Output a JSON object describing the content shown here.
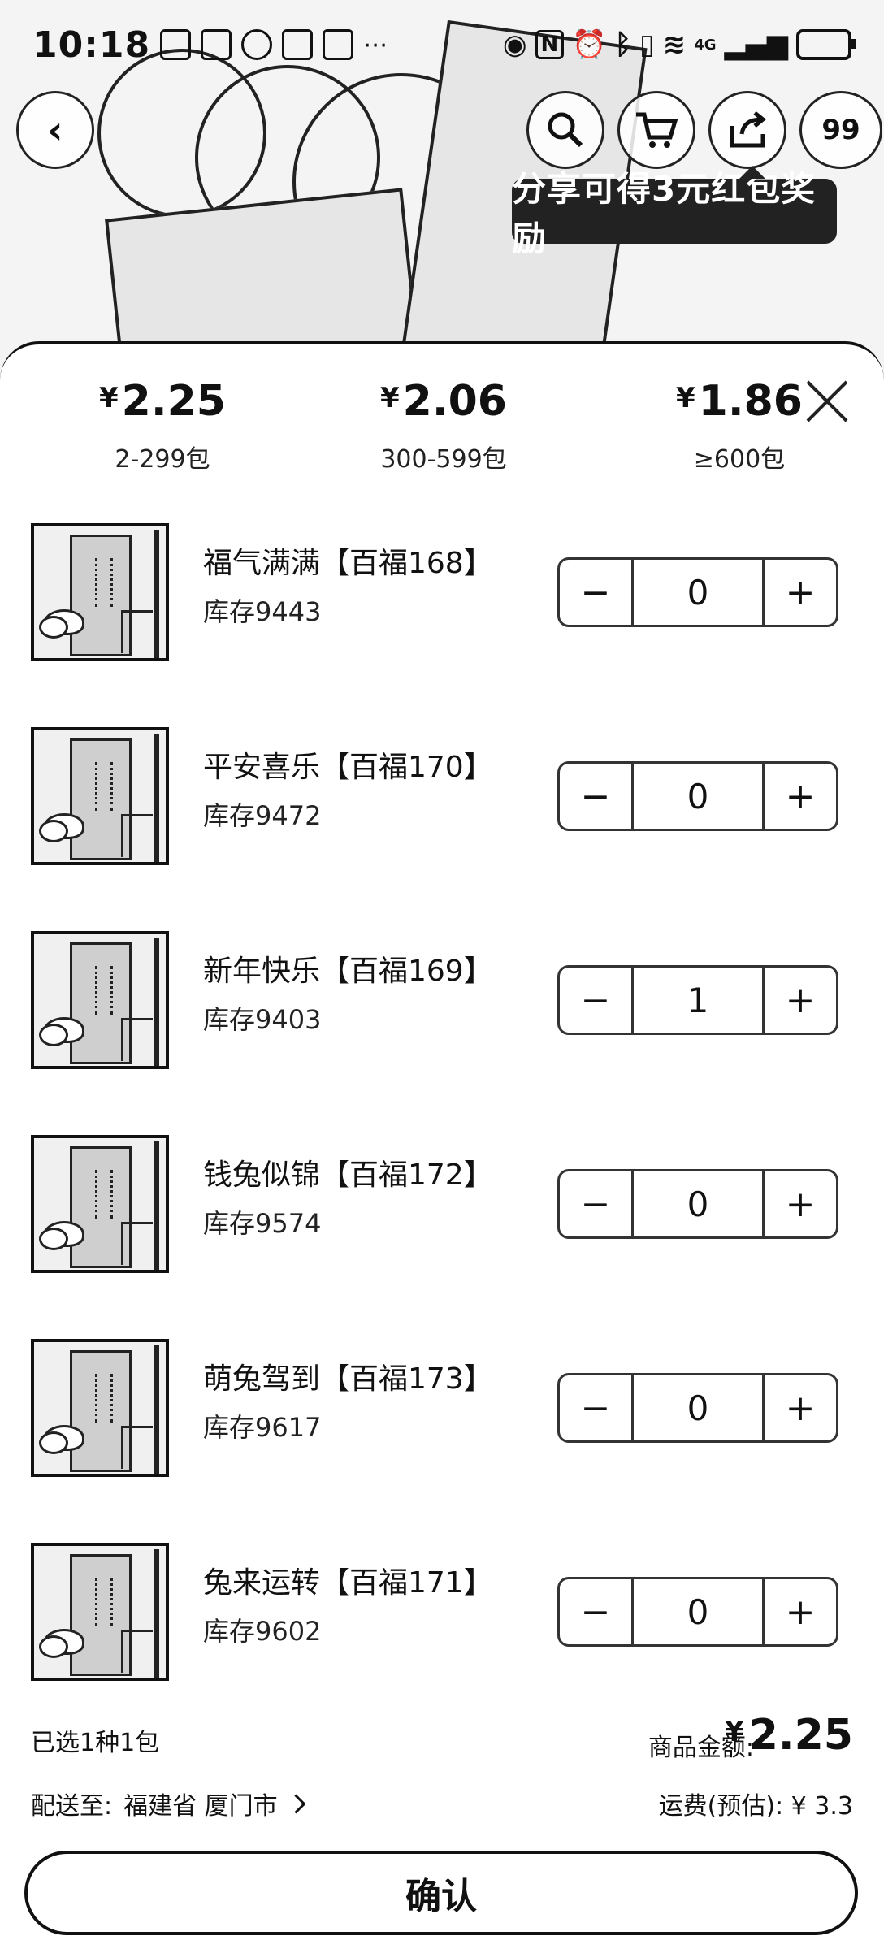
{
  "status_bar": {
    "time": "10:18",
    "signal_label": "4G",
    "icons": [
      "gallery-icon",
      "search-app-icon",
      "sync-icon",
      "hand-icon",
      "square-icon",
      "more-dots-icon",
      "eye-icon",
      "nfc-icon",
      "alarm-icon",
      "bluetooth-icon",
      "vibrate-icon",
      "wifi-icon",
      "signal-icon",
      "battery-icon"
    ]
  },
  "header": {
    "back_icon": "chevron-left-icon",
    "search_icon": "search-icon",
    "cart_icon": "cart-icon",
    "share_icon": "share-icon",
    "message_badge": "99",
    "share_tip": "分享可得3元红包奖励"
  },
  "price_tiers": [
    {
      "currency": "¥",
      "price": "2.25",
      "range": "2-299包"
    },
    {
      "currency": "¥",
      "price": "2.06",
      "range": "300-599包"
    },
    {
      "currency": "¥",
      "price": "1.86",
      "range": "≥600包"
    }
  ],
  "products": [
    {
      "name": "福气满满【百福168】",
      "stock": "库存9443",
      "qty": "0"
    },
    {
      "name": "平安喜乐【百福170】",
      "stock": "库存9472",
      "qty": "0"
    },
    {
      "name": "新年快乐【百福169】",
      "stock": "库存9403",
      "qty": "1"
    },
    {
      "name": "钱兔似锦【百福172】",
      "stock": "库存9574",
      "qty": "0"
    },
    {
      "name": "萌兔驾到【百福173】",
      "stock": "库存9617",
      "qty": "0"
    },
    {
      "name": "兔来运转【百福171】",
      "stock": "库存9602",
      "qty": "0"
    }
  ],
  "stepper": {
    "minus": "−",
    "plus": "+"
  },
  "footer": {
    "selected": "已选1种1包",
    "amount_label": "商品金额:",
    "amount_currency": "¥",
    "amount": "2.25",
    "ship_label": "配送至:",
    "ship_region": "福建省 厦门市",
    "freight": "运费(预估): ¥ 3.3",
    "confirm": "确认"
  }
}
